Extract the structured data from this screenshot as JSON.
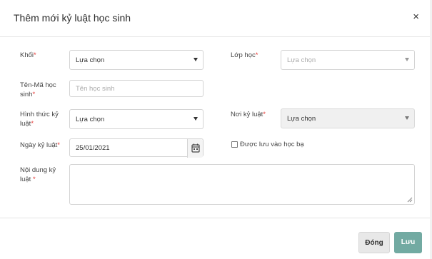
{
  "dialog": {
    "title": "Thêm mới kỷ luật học sinh",
    "close_symbol": "×"
  },
  "form": {
    "required_mark": "*",
    "khoi": {
      "label": "Khối",
      "value": "Lựa chọn"
    },
    "lop_hoc": {
      "label": "Lớp học",
      "placeholder": "Lựa chọn"
    },
    "ten_ma_hoc_sinh": {
      "label_line1": "Tên-Mã học",
      "label_line2": "sinh",
      "placeholder": "Tên học sinh"
    },
    "hinh_thuc": {
      "label_line1": "Hình thức kỷ",
      "label_line2": "luật",
      "value": "Lựa chọn"
    },
    "noi_ky_luat": {
      "label": "Nơi kỷ luật",
      "value": "Lựa chọn"
    },
    "ngay_ky_luat": {
      "label": "Ngày kỷ luật",
      "value": "25/01/2021"
    },
    "luu_hoc_ba": {
      "label": "Được lưu vào học bạ"
    },
    "noi_dung": {
      "label_line1": "Nội dung kỷ",
      "label_line2": "luật",
      "value": ""
    }
  },
  "footer": {
    "close_label": "Đóng",
    "save_label": "Lưu",
    "save_color": "#72aaa2"
  },
  "icons": [
    "close-icon",
    "chevron-down-icon",
    "calendar-icon",
    "resize-handle-icon"
  ]
}
